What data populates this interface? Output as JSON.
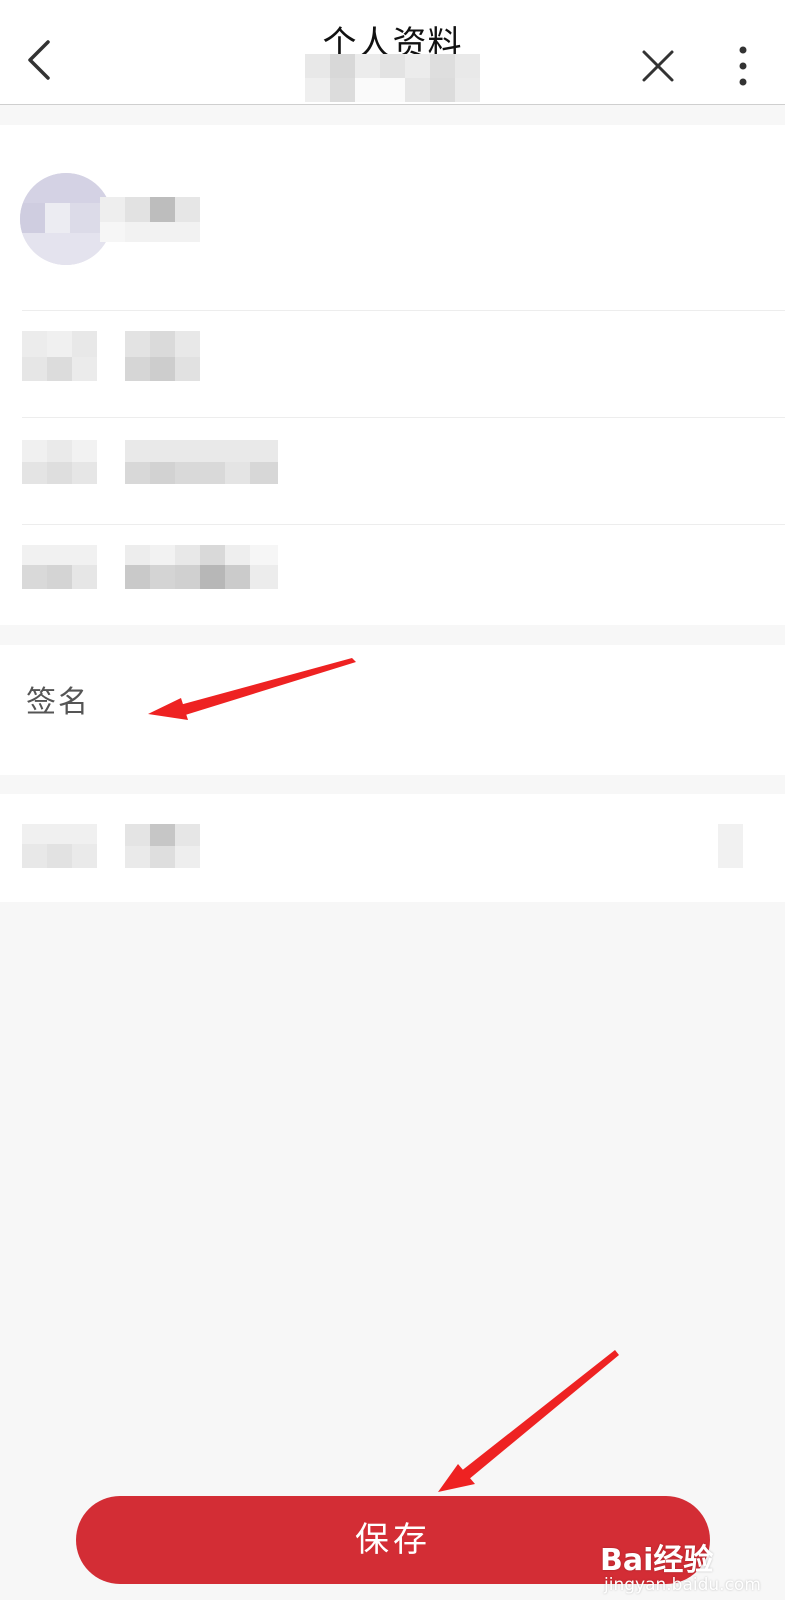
{
  "header": {
    "title": "个人资料",
    "back_icon": "chevron-left-icon",
    "close_icon": "close-icon",
    "more_icon": "more-vertical-icon"
  },
  "profile": {
    "avatar_icon": "avatar"
  },
  "signature": {
    "label": "签名"
  },
  "actions": {
    "save_label": "保存",
    "save_color": "#d32d35"
  },
  "annotations": {
    "arrow_color": "#ee2222"
  },
  "watermark": {
    "logo": "Bai经验",
    "url": "jingyan.baidu.com"
  },
  "colors": {
    "page_bg": "#f7f7f7",
    "card_bg": "#ffffff"
  }
}
